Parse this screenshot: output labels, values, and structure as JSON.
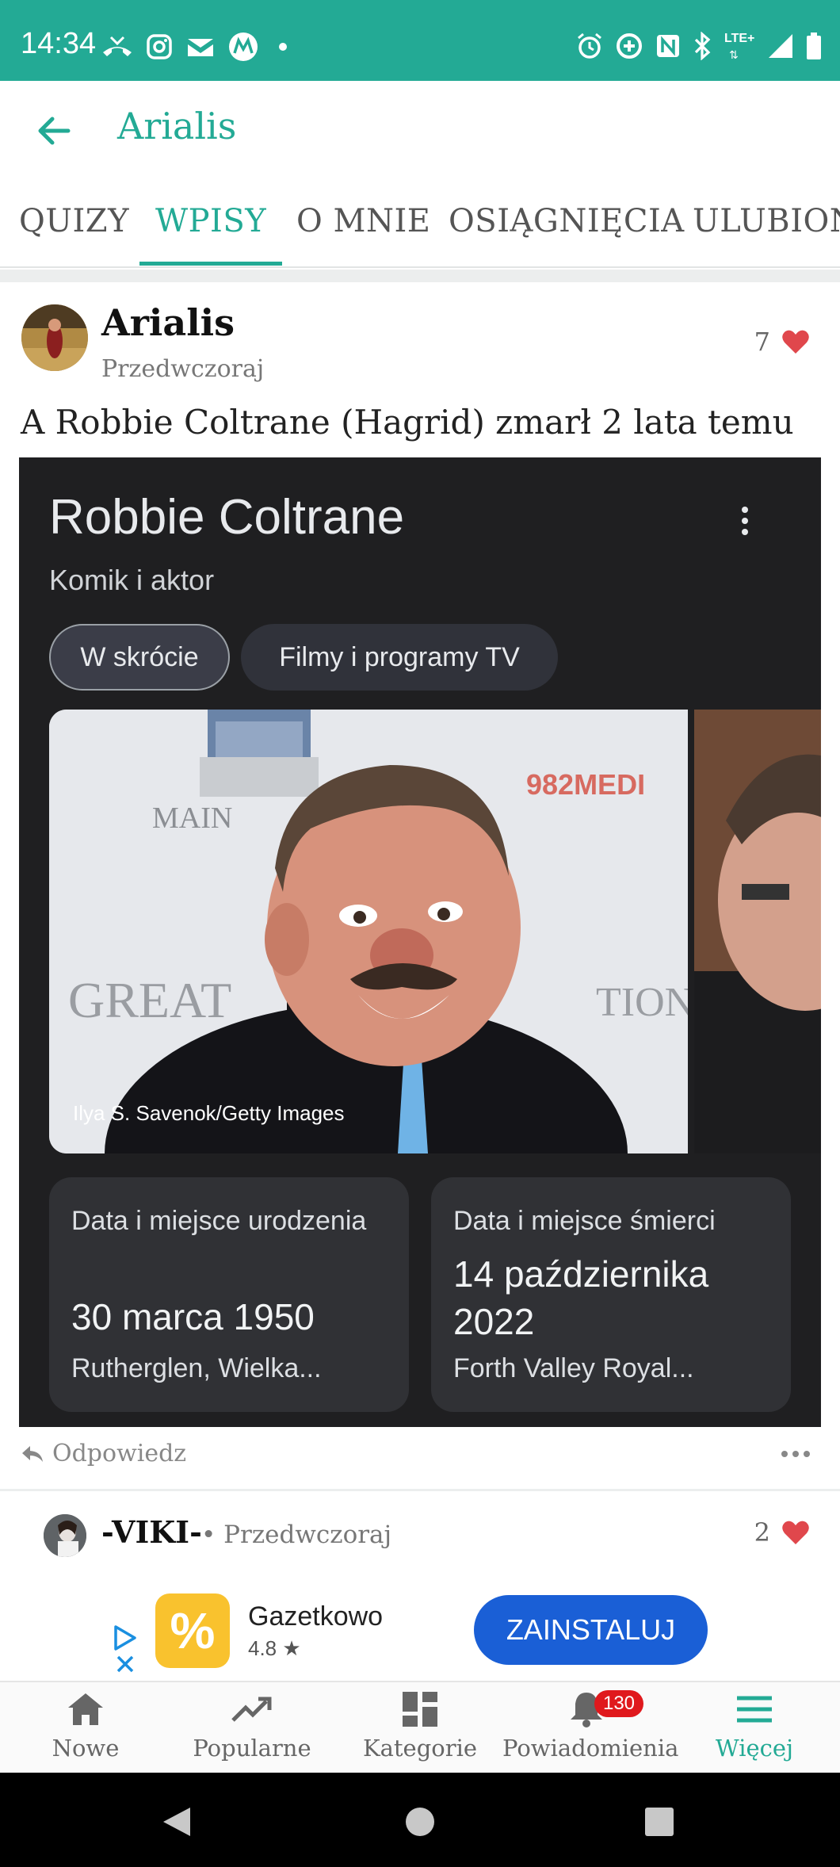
{
  "status_bar": {
    "time": "14:34",
    "left_icons": [
      "missed-call-icon",
      "instagram-icon",
      "mail-icon",
      "motorola-icon",
      "dot-icon"
    ],
    "right_icons": [
      "alarm-icon",
      "data-saver-icon",
      "nfc-icon",
      "bluetooth-icon",
      "lte-icon",
      "signal-icon",
      "battery-icon"
    ],
    "lte_label": "LTE+"
  },
  "app_bar": {
    "title": "Arialis",
    "back_icon": "arrow-left-icon"
  },
  "tabs": [
    {
      "label": "QUIZY",
      "active": false
    },
    {
      "label": "WPISY",
      "active": true
    },
    {
      "label": "O MNIE",
      "active": false
    },
    {
      "label": "OSIĄGNIĘCIA",
      "active": false
    },
    {
      "label": "ULUBION",
      "active": false
    }
  ],
  "post": {
    "author": "Arialis",
    "date": "Przedwczoraj",
    "likes": "7",
    "text": "A Robbie Coltrane (Hagrid) zmarł 2 lata temu",
    "reply_label": "Odpowiedz"
  },
  "embed": {
    "title": "Robbie Coltrane",
    "subtitle": "Komik i aktor",
    "chips": [
      "W skrócie",
      "Filmy i programy TV"
    ],
    "photo_credit": "Ilya S. Savenok/Getty Images",
    "backdrop_text": {
      "main": "MAIN",
      "great": "GREAT",
      "tions": "TIONS",
      "media": "982MEDI"
    },
    "cards": [
      {
        "label": "Data i miejsce urodzenia",
        "value": "30 marca 1950",
        "place": "Rutherglen, Wielka..."
      },
      {
        "label": "Data i miejsce śmierci",
        "value": "14 października 2022",
        "place": "Forth Valley Royal..."
      }
    ]
  },
  "comment": {
    "author": "-VIKI-",
    "meta": "• Przedwczoraj",
    "likes": "2"
  },
  "ad": {
    "name": "Gazetkowo",
    "rating": "4.8 ★",
    "logo_symbol": "%",
    "button": "ZAINSTALUJ"
  },
  "bottom_nav": [
    {
      "label": "Nowe",
      "icon": "home-icon",
      "active": false
    },
    {
      "label": "Popularne",
      "icon": "trending-icon",
      "active": false
    },
    {
      "label": "Kategorie",
      "icon": "dashboard-icon",
      "active": false
    },
    {
      "label": "Powiadomienia",
      "icon": "bell-icon",
      "active": false,
      "badge": "130"
    },
    {
      "label": "Więcej",
      "icon": "menu-icon",
      "active": true
    }
  ],
  "colors": {
    "accent": "#23aa95",
    "heart": "#e0474c",
    "badge": "#e0191d",
    "ad_button": "#1a5fd6"
  }
}
